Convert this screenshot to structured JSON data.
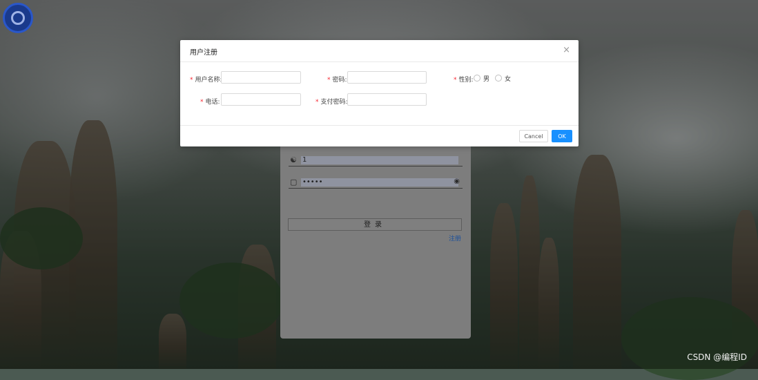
{
  "modal": {
    "title": "用户注册",
    "close_icon": "×",
    "fields": {
      "username_label": "用户名称:",
      "password_label": "密码:",
      "gender_label": "性别:",
      "phone_label": "电话:",
      "pay_password_label": "支付密码:"
    },
    "gender_options": [
      "男",
      "女"
    ],
    "required_mark": "*",
    "cancel_label": "Cancel",
    "ok_label": "OK"
  },
  "login": {
    "username_value": "1",
    "password_value": "•••••",
    "login_button": "登录",
    "register_link": "注册"
  },
  "watermark": "CSDN @编程ID",
  "colors": {
    "primary": "#1890ff",
    "required": "#f5222d"
  }
}
